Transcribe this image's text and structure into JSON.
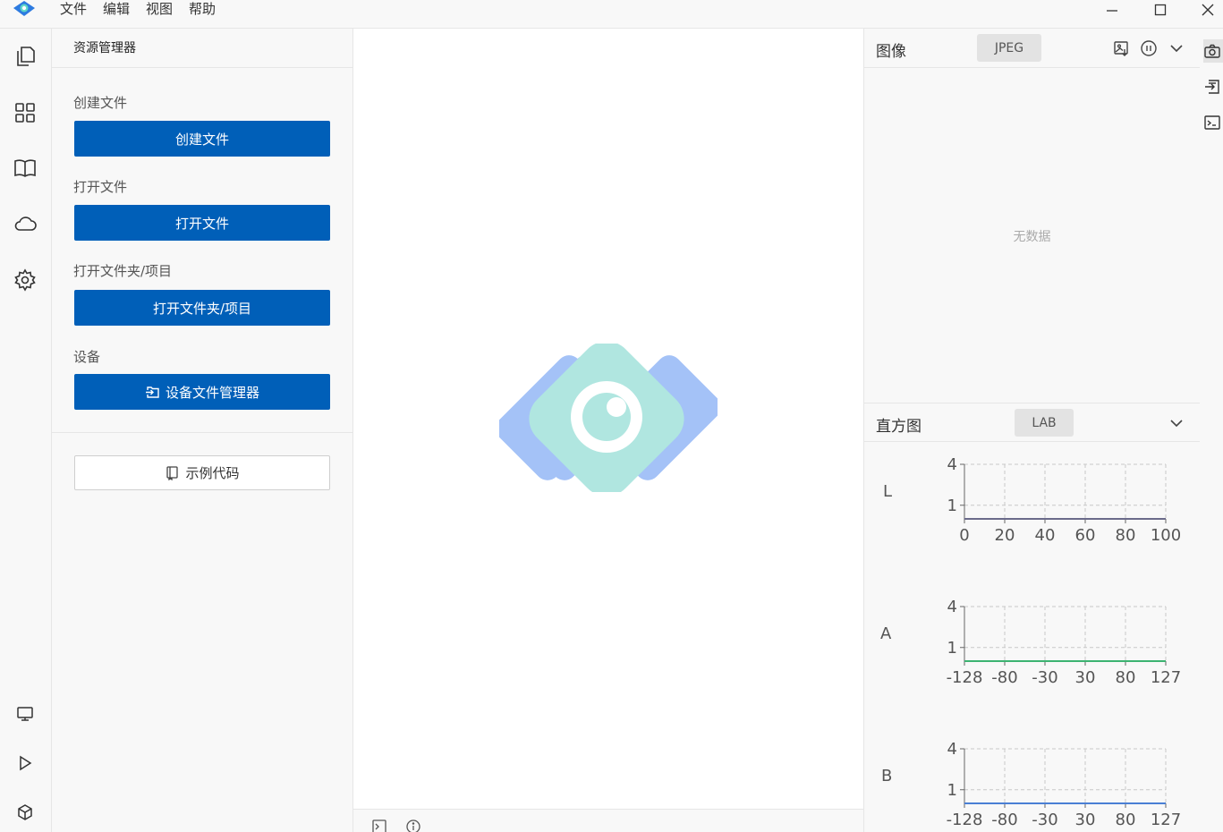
{
  "menu": {
    "items": [
      "文件",
      "编辑",
      "视图",
      "帮助"
    ]
  },
  "explorer": {
    "title": "资源管理器",
    "create_label": "创建文件",
    "create_button": "创建文件",
    "open_label": "打开文件",
    "open_button": "打开文件",
    "folder_label": "打开文件夹/项目",
    "folder_button": "打开文件夹/项目",
    "device_label": "设备",
    "device_button": "设备文件管理器",
    "example_button": "示例代码"
  },
  "image_panel": {
    "title": "图像",
    "format": "JPEG",
    "empty_text": "无数据"
  },
  "histogram_panel": {
    "title": "直方图",
    "color_space": "LAB"
  },
  "colors": {
    "accent": "#005fb8",
    "logo_blue": "#a4c2f7",
    "logo_teal": "#b0e6e0",
    "hist_l": "#6b6b8a",
    "hist_a": "#3cb371",
    "hist_b": "#4a7fd4"
  },
  "chart_data": [
    {
      "type": "line",
      "series": [
        {
          "name": "L",
          "values": [
            0,
            0
          ]
        }
      ],
      "x": [
        0,
        100
      ],
      "xticks": [
        "0",
        "20",
        "40",
        "60",
        "80",
        "100"
      ],
      "yticks": [
        "4",
        "1"
      ],
      "xlim": [
        0,
        100
      ],
      "ylim": [
        0,
        4
      ],
      "grid": true
    },
    {
      "type": "line",
      "series": [
        {
          "name": "A",
          "values": [
            0,
            0
          ]
        }
      ],
      "x": [
        -128,
        127
      ],
      "xticks": [
        "-128",
        "-80",
        "-30",
        "30",
        "80",
        "127"
      ],
      "yticks": [
        "4",
        "1"
      ],
      "xlim": [
        -128,
        127
      ],
      "ylim": [
        0,
        4
      ],
      "grid": true
    },
    {
      "type": "line",
      "series": [
        {
          "name": "B",
          "values": [
            0,
            0
          ]
        }
      ],
      "x": [
        -128,
        127
      ],
      "xticks": [
        "-128",
        "-80",
        "-30",
        "30",
        "80",
        "127"
      ],
      "yticks": [
        "4",
        "1"
      ],
      "xlim": [
        -128,
        127
      ],
      "ylim": [
        0,
        4
      ],
      "grid": true
    }
  ]
}
